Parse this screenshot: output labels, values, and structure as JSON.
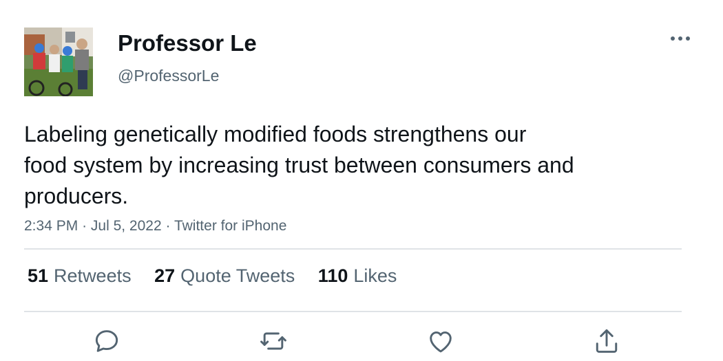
{
  "tweet": {
    "author": {
      "display_name": "Professor Le",
      "handle": "@ProfessorLe"
    },
    "text_lines": [
      "Labeling genetically modified foods strengthens our",
      "food system by increasing trust between consumers and",
      "producers."
    ],
    "time": "2:34 PM",
    "date": "Jul 5, 2022",
    "source": "Twitter for iPhone",
    "separator": "·",
    "stats": {
      "retweets_count": "51",
      "retweets_label": "Retweets",
      "quotes_count": "27",
      "quotes_label": "Quote Tweets",
      "likes_count": "110",
      "likes_label": "Likes"
    }
  },
  "icons": {
    "more": "more-horizontal-icon",
    "reply": "reply-icon",
    "retweet": "retweet-icon",
    "like": "heart-icon",
    "share": "share-icon"
  },
  "colors": {
    "text_primary": "#0f1419",
    "text_secondary": "#536471",
    "divider": "#dfe3e6"
  }
}
